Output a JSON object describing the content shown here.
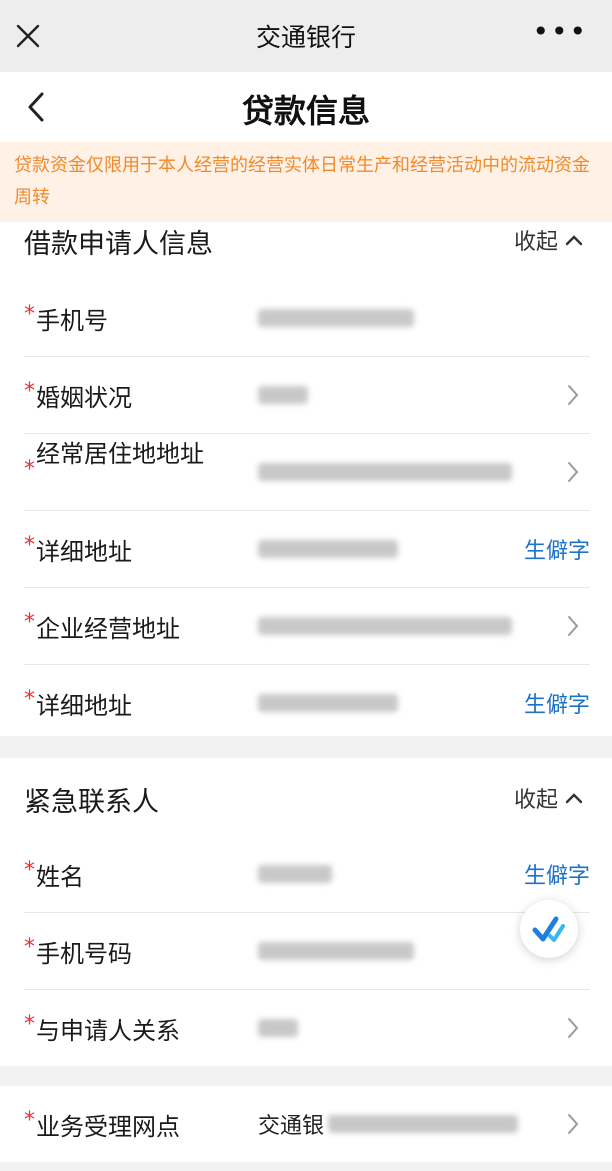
{
  "window": {
    "title": "交通银行",
    "more_label": "•••"
  },
  "page": {
    "title": "贷款信息"
  },
  "notice": {
    "text": "贷款资金仅限用于本人经营的经营实体日常生产和经营活动中的流动资金周转"
  },
  "applicant": {
    "section_title": "借款申请人信息",
    "collapse_label": "收起",
    "rows": [
      {
        "label": "手机号"
      },
      {
        "label": "婚姻状况"
      },
      {
        "label": "经常居住地地址"
      },
      {
        "label": "详细地址",
        "action": "生僻字"
      },
      {
        "label": "企业经营地址"
      },
      {
        "label": "详细地址",
        "action": "生僻字"
      }
    ]
  },
  "contact": {
    "section_title": "紧急联系人",
    "collapse_label": "收起",
    "rows": [
      {
        "label": "姓名",
        "action": "生僻字"
      },
      {
        "label": "手机号码"
      },
      {
        "label": "与申请人关系"
      }
    ]
  },
  "branch": {
    "label": "业务受理网点",
    "value_prefix": "交通银"
  },
  "required_mark": "*",
  "colors": {
    "accent": "#1e73c8",
    "notice_text": "#f08a2a",
    "notice_bg": "#fff1e6",
    "required": "#e33333"
  },
  "icons": {
    "close": "close-icon",
    "more": "more-icon",
    "back": "back-arrow-icon",
    "chevron": "chevron-right-icon",
    "collapse": "chevron-up-icon",
    "fab": "check-badge-icon"
  }
}
